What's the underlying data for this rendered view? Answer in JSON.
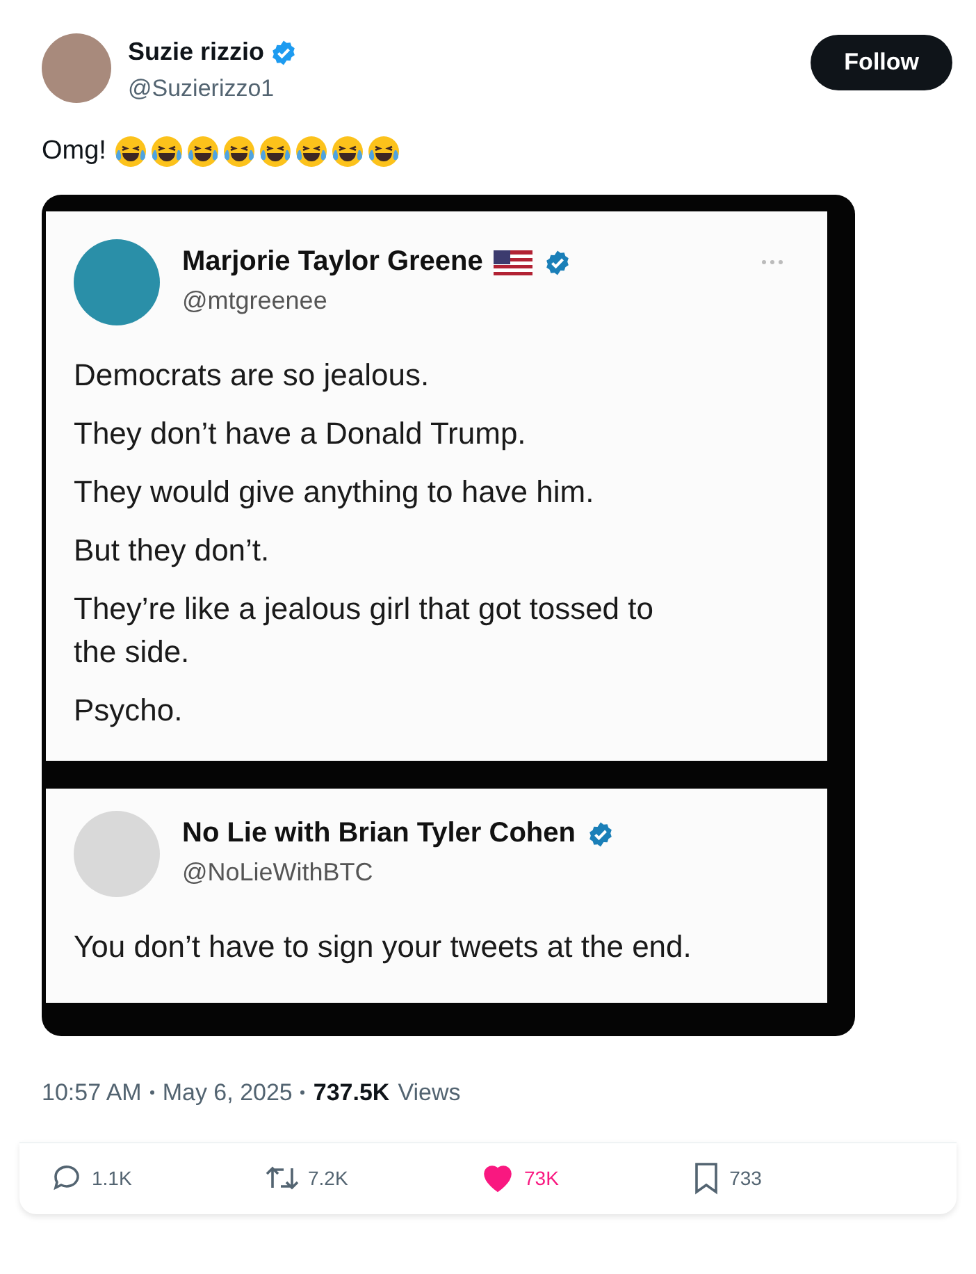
{
  "author": {
    "name": "Suzie rizzio",
    "handle": "@Suzierizzo1",
    "verified": true
  },
  "follow_button": "Follow",
  "text": "Omg!",
  "emojis": [
    {
      "kind": "laughing"
    },
    {
      "kind": "laughing"
    },
    {
      "kind": "laughing"
    },
    {
      "kind": "laughing"
    },
    {
      "kind": "laughing"
    },
    {
      "kind": "laughing"
    },
    {
      "kind": "laughing"
    },
    {
      "kind": "laughing"
    }
  ],
  "embedded_image": {
    "tweets": [
      {
        "name": "Marjorie Taylor Greene",
        "flag": true,
        "verified": true,
        "more": true,
        "handle": "@mtgreenee",
        "lines": [
          "Democrats are so jealous.",
          "They don’t have a Donald Trump.",
          "They would give anything to have him.",
          "But they don’t.",
          "They’re like a jealous girl that got tossed to the side.",
          "Psycho."
        ]
      },
      {
        "name": "No Lie with Brian Tyler Cohen",
        "flag": false,
        "verified": true,
        "more": false,
        "handle": "@NoLieWithBTC",
        "lines": [
          "You don’t have to sign your tweets at the end."
        ]
      }
    ]
  },
  "meta": {
    "time": "10:57 AM",
    "date": "May 6, 2025",
    "views_count": "737.5K",
    "views_label": "Views"
  },
  "actions": [
    {
      "kind": "reply",
      "count": "1.1K",
      "active": false
    },
    {
      "kind": "repost",
      "count": "7.2K",
      "active": false
    },
    {
      "kind": "like",
      "count": "73K",
      "active": true
    },
    {
      "kind": "bookmark",
      "count": "733",
      "active": false
    }
  ]
}
